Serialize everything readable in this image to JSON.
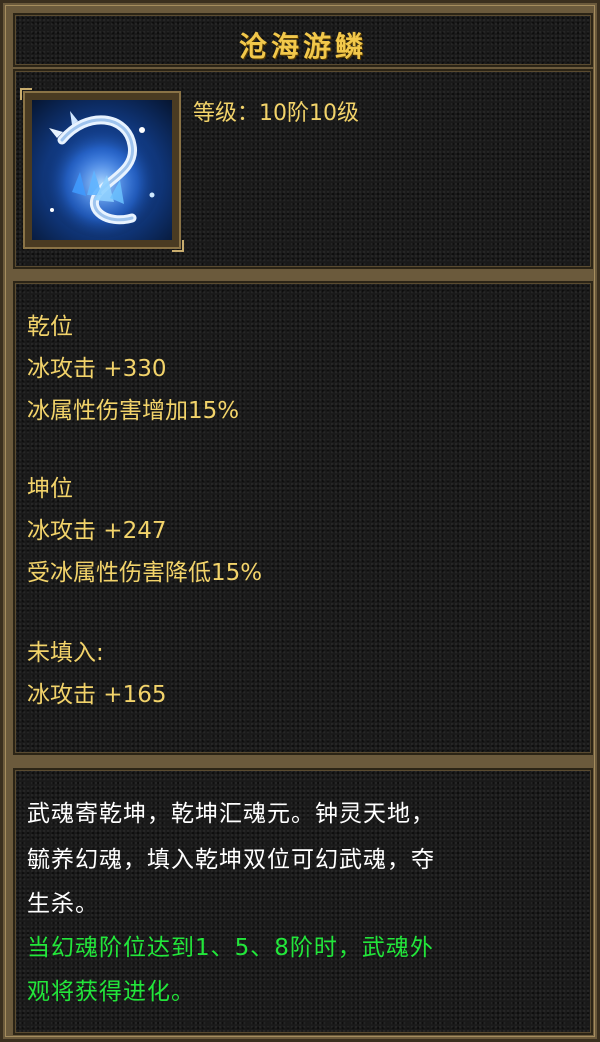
{
  "item": {
    "name": "沧海游鳞",
    "level_text": "等级：10阶10级",
    "icon": "ice-dragon-icon"
  },
  "stats": {
    "qian_header": "乾位",
    "qian_line1": "冰攻击 +330",
    "qian_line2": "冰属性伤害增加15%",
    "kun_header": "坤位",
    "kun_line1": "冰攻击 +247",
    "kun_line2": "受冰属性伤害降低15%",
    "unfilled_header": "未填入:",
    "unfilled_line1": "冰攻击 +165"
  },
  "description": {
    "line1": "武魂寄乾坤，乾坤汇魂元。钟灵天地，",
    "line2": "毓养幻魂，填入乾坤双位可幻武魂，夺",
    "line3": "生杀。",
    "green_line1": "当幻魂阶位达到1、5、8阶时，武魂外",
    "green_line2": "观将获得进化。"
  },
  "colors": {
    "title": "#f2c84b",
    "stat_text": "#f2d36a",
    "desc_text": "#ffffff",
    "highlight": "#22e63a"
  }
}
